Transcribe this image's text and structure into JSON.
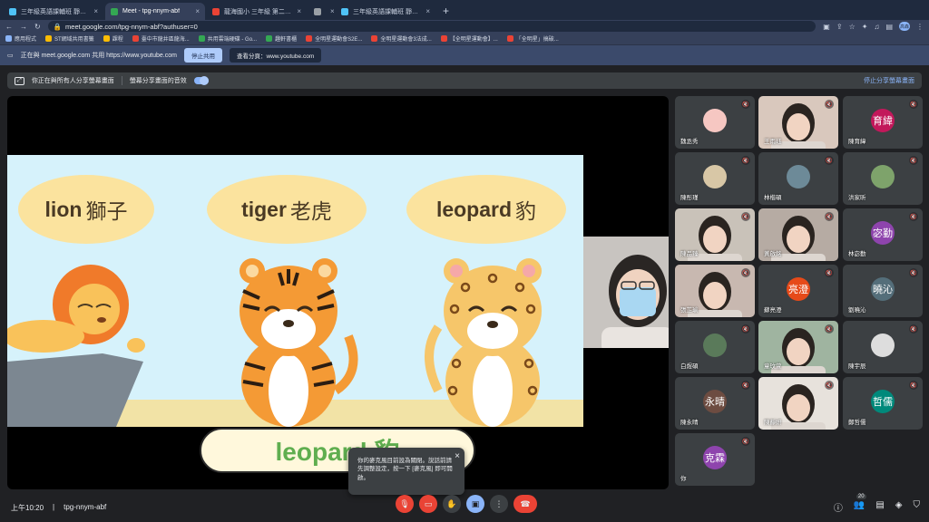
{
  "browser": {
    "tabs": [
      {
        "label": "三年級英語課輔班 靜宜大學英語...",
        "color": "#4fc3f7",
        "active": false
      },
      {
        "label": "Meet - tpg-nnym-abf",
        "color": "#34a853",
        "active": true
      },
      {
        "label": "龍海國小 三年級 第二組 - Y...",
        "color": "#ea4335",
        "active": false
      },
      {
        "label": "",
        "color": "#9aa0a6",
        "active": false
      },
      {
        "label": "三年級英語課輔班 靜宜大學英語...",
        "color": "#4fc3f7",
        "active": false
      }
    ],
    "new_tab": "+",
    "url": "meet.google.com/tpg-nnym-abf?authuser=0",
    "profile": "高森",
    "bookmarks": [
      {
        "label": "應用程式",
        "color": "#8ab4f8"
      },
      {
        "label": "ST網域共用書籤",
        "color": "#fbbc04"
      },
      {
        "label": "課程",
        "color": "#fbbc04"
      },
      {
        "label": "臺中市龍井區龍海...",
        "color": "#ea4335"
      },
      {
        "label": "共用雲端硬碟 - Go...",
        "color": "#34a853"
      },
      {
        "label": "趣軒書櫃",
        "color": "#34a853"
      },
      {
        "label": "全明星運動會S2E...",
        "color": "#ea4335"
      },
      {
        "label": "全明星運動會3法成...",
        "color": "#ea4335"
      },
      {
        "label": "【全明星運動會】...",
        "color": "#ea4335"
      },
      {
        "label": "「全明星」搞破...",
        "color": "#ea4335"
      }
    ],
    "share_notice": "正在與 meet.google.com 共用 https://www.youtube.com",
    "stop_share": "停止共用",
    "switch_share": "查看分頁：www.youtube.com"
  },
  "meet": {
    "presenting_text": "你正在與所有人分享螢幕畫面",
    "audio_label": "螢幕分享畫面的音效",
    "stop_presenting": "停止分享螢幕畫面",
    "slide": {
      "clouds": [
        {
          "en": "lion",
          "zh": "獅子"
        },
        {
          "en": "tiger",
          "zh": "老虎"
        },
        {
          "en": "leopard",
          "zh": "豹"
        }
      ],
      "caption": "leopard 豹"
    },
    "toast": {
      "text": "你的麥克風目前設為關閉。說話前請先調整設定，按一下 [麥克風] 即可開啟。",
      "close": "×"
    },
    "participants": [
      {
        "name": "魏丞秀",
        "avatar": "",
        "color": "#f6c7c2",
        "type": "photo"
      },
      {
        "name": "王雨珏",
        "avatar": "",
        "color": "#d9c8bd",
        "type": "video"
      },
      {
        "name": "陳育緯",
        "avatar": "育緯",
        "color": "#c2185b",
        "type": "letter"
      },
      {
        "name": "陳彤瑾",
        "avatar": "",
        "color": "#d8c7a6",
        "type": "photo"
      },
      {
        "name": "林楷碩",
        "avatar": "",
        "color": "#6d8a98",
        "type": "photo"
      },
      {
        "name": "洪家昕",
        "avatar": "",
        "color": "#7ea36b",
        "type": "photo"
      },
      {
        "name": "陳品臻",
        "avatar": "",
        "color": "#c9c2b9",
        "type": "video"
      },
      {
        "name": "黃啟銘",
        "avatar": "",
        "color": "#b6aba3",
        "type": "video"
      },
      {
        "name": "林宓勤",
        "avatar": "宓勤",
        "color": "#8e44ad",
        "type": "letter"
      },
      {
        "name": "張芷瑜",
        "avatar": "",
        "color": "#c8b8b0",
        "type": "video"
      },
      {
        "name": "蘇亮澄",
        "avatar": "亮澄",
        "color": "#e64a19",
        "type": "letter"
      },
      {
        "name": "劉曉沁",
        "avatar": "曉沁",
        "color": "#546e7a",
        "type": "letter"
      },
      {
        "name": "白煜碩",
        "avatar": "",
        "color": "#5a7a5a",
        "type": "photo"
      },
      {
        "name": "童玟萱",
        "avatar": "",
        "color": "#9fb4a0",
        "type": "video"
      },
      {
        "name": "陳宇辰",
        "avatar": "",
        "color": "#dddddd",
        "type": "photo"
      },
      {
        "name": "陳永晴",
        "avatar": "永晴",
        "color": "#6d4c41",
        "type": "letter"
      },
      {
        "name": "陳靜妍",
        "avatar": "",
        "color": "#e7e2dc",
        "type": "video"
      },
      {
        "name": "鄭哲儒",
        "avatar": "哲儒",
        "color": "#00897b",
        "type": "letter"
      },
      {
        "name": "你",
        "avatar": "克霖",
        "color": "#8e44ad",
        "type": "letter"
      }
    ],
    "bottom": {
      "time": "上午10:20",
      "meeting_code": "tpg-nnym-abf",
      "participant_count": "20"
    }
  }
}
